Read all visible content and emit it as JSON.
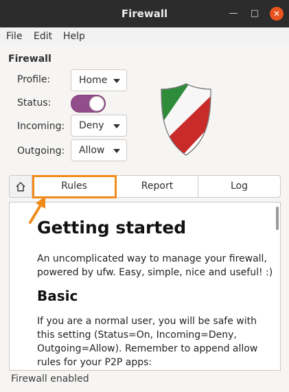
{
  "window": {
    "title": "Firewall",
    "minimize_glyph": "—",
    "maximize_glyph": "□",
    "close_glyph": "✕"
  },
  "menu": [
    "File",
    "Edit",
    "Help"
  ],
  "panel": {
    "section_title": "Firewall",
    "profile": {
      "label": "Profile:",
      "value": "Home"
    },
    "status": {
      "label": "Status:",
      "on": true
    },
    "incoming": {
      "label": "Incoming:",
      "value": "Deny"
    },
    "outgoing": {
      "label": "Outgoing:",
      "value": "Allow"
    },
    "logo_icon": "gufw-shield-icon"
  },
  "tabs": {
    "home_icon": "home-icon",
    "rules": "Rules",
    "report": "Report",
    "log": "Log",
    "highlighted": "Rules"
  },
  "content": {
    "heading": "Getting started",
    "intro": "An uncomplicated way to manage your firewall, powered by ufw. Easy, simple, nice and useful! :)",
    "basic_heading": "Basic",
    "basic_text": "If you are a normal user, you will be safe with this setting (Status=On, Incoming=Deny, Outgoing=Allow). Remember to append allow rules for your P2P apps:"
  },
  "status_bar": "Firewall enabled",
  "colors": {
    "titlebar": "#2c2c2c",
    "switch_on": "#924d8b",
    "close_button": "#e95420",
    "annotation": "#f28a1a"
  }
}
